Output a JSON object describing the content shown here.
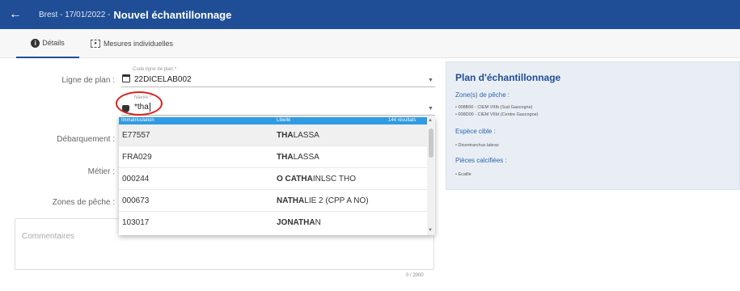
{
  "header": {
    "back_icon": "arrow-left-icon",
    "breadcrumb": "Brest - 17/01/2022 -",
    "title": "Nouvel échantillonnage"
  },
  "tabs": [
    {
      "label": "Détails",
      "icon": "info-icon",
      "active": true
    },
    {
      "label": "Mesures individuelles",
      "icon": "measure-icon",
      "active": false
    }
  ],
  "form": {
    "ligne_plan": {
      "label": "Ligne de plan :",
      "small_label": "Code ligne de plan *",
      "value": "22DICELAB002"
    },
    "navire": {
      "small_label": "Navire *",
      "value": "*tha"
    },
    "debarquement": {
      "label": "Débarquement :"
    },
    "metier": {
      "label": "Métier :"
    },
    "zones": {
      "label": "Zones de pêche :"
    },
    "comments": {
      "placeholder": "Commentaires",
      "counter": "0 / 2000"
    }
  },
  "dropdown": {
    "headers": {
      "col1": "Immatriculation",
      "col2": "Libellé",
      "count": "144 résultats"
    },
    "rows": [
      {
        "immat": "E77557",
        "bold": "THA",
        "rest": "LASSA"
      },
      {
        "immat": "FRA029",
        "bold": "THA",
        "rest": "LASSA"
      },
      {
        "immat": "000244",
        "bold": "O CATHA",
        "rest": "INLSC THO"
      },
      {
        "immat": "000673",
        "bold": "NATHA",
        "rest": "LIE 2 (CPP A NO)"
      },
      {
        "immat": "103017",
        "bold": "JONATHA",
        "rest": "N"
      }
    ]
  },
  "plan": {
    "title": "Plan d'échantillonnage",
    "zones_label": "Zone(s) de pêche :",
    "zones": [
      "008B00 - CIEM VIIIb (Sud Gascogne)",
      "008D00 - CIEM VIIId (Centre Gascogne)"
    ],
    "espece_label": "Espèce cible :",
    "espece": [
      "Dicentrarchus labrax"
    ],
    "pieces_label": "Pièces calcifiées :",
    "pieces": [
      "Ecaille"
    ]
  },
  "colors": {
    "primary": "#1f4e96",
    "dropdown_header": "#2f9be3",
    "highlight": "#d9231e"
  }
}
